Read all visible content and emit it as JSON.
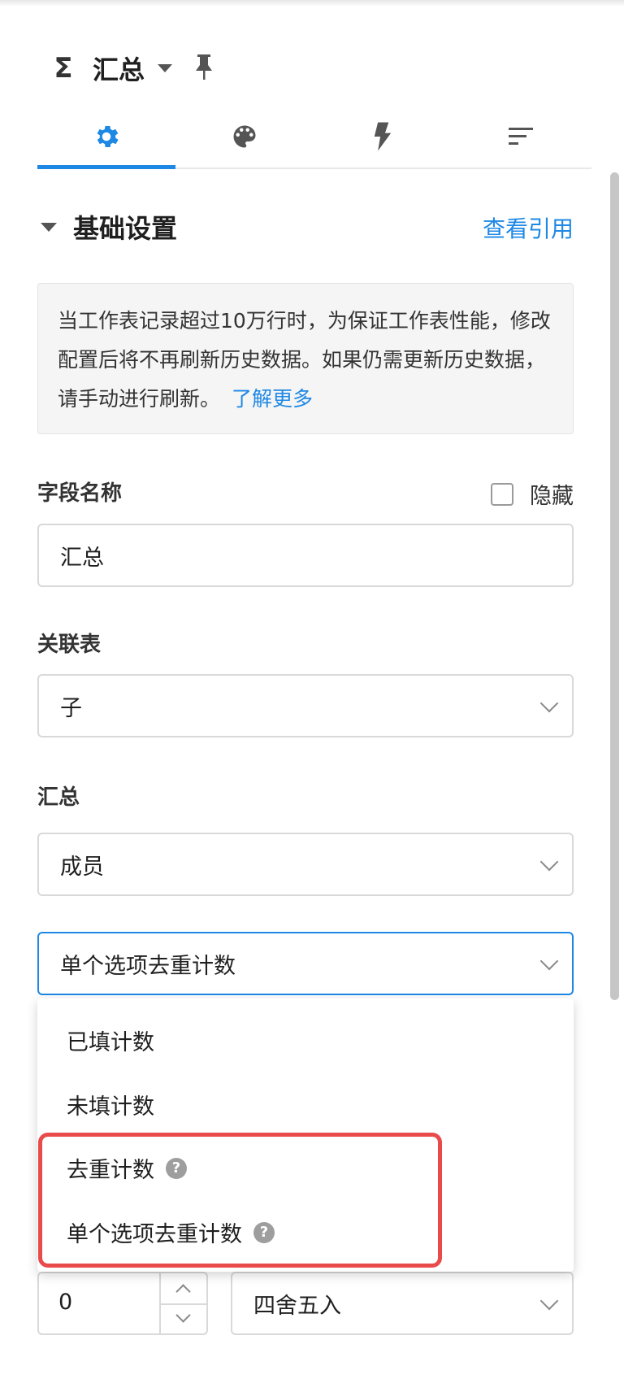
{
  "header": {
    "title": "汇总",
    "icon": "sigma-icon"
  },
  "tabs": [
    {
      "name": "settings",
      "icon": "gear-icon",
      "active": true
    },
    {
      "name": "style",
      "icon": "palette-icon",
      "active": false
    },
    {
      "name": "actions",
      "icon": "lightning-icon",
      "active": false
    },
    {
      "name": "sort",
      "icon": "sort-icon",
      "active": false
    }
  ],
  "section": {
    "title": "基础设置",
    "view_ref": "查看引用",
    "notice_text": "当工作表记录超过10万行时，为保证工作表性能，修改配置后将不再刷新历史数据。如果仍需更新历史数据，请手动进行刷新。",
    "notice_link": "了解更多"
  },
  "field_name": {
    "label": "字段名称",
    "hidden_label": "隐藏",
    "hidden_checked": false,
    "value": "汇总"
  },
  "relation_table": {
    "label": "关联表",
    "value": "子"
  },
  "summary": {
    "label": "汇总",
    "field_value": "成员",
    "method_value": "单个选项去重计数"
  },
  "menu": {
    "options": [
      {
        "label": "已填计数",
        "help": false
      },
      {
        "label": "未填计数",
        "help": false
      },
      {
        "label": "去重计数",
        "help": true
      },
      {
        "label": "单个选项去重计数",
        "help": true
      }
    ],
    "help_glyph": "?"
  },
  "precision": {
    "value": "0",
    "rounding": "四舍五入"
  },
  "colors": {
    "accent": "#1e88e5",
    "highlight": "#e94b4b"
  }
}
